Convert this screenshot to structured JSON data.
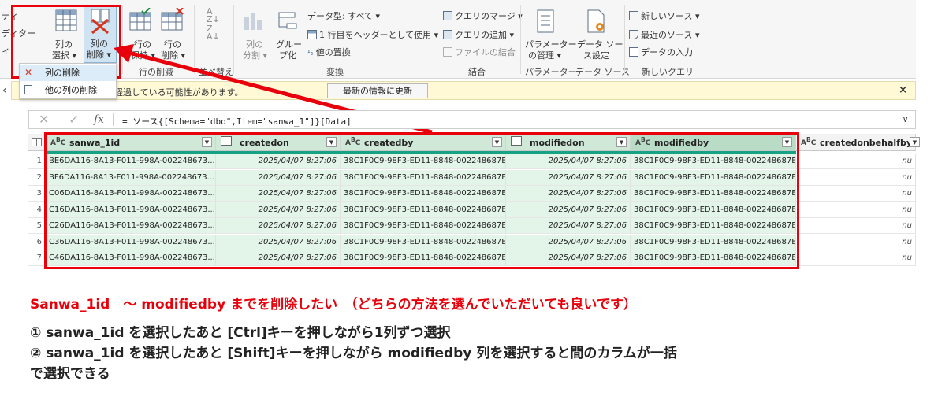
{
  "ribbon": {
    "left_partial_1": "ティ",
    "left_partial_2": "ディター",
    "left_partial_3": "ィ",
    "choose_cols_1": "列の",
    "choose_cols_2": "選択 ▾",
    "remove_cols_1": "列の",
    "remove_cols_2": "削除 ▾",
    "keep_rows_1": "行の",
    "keep_rows_2": "保持 ▾",
    "remove_rows_1": "行の",
    "remove_rows_2": "削除 ▾",
    "group_rows": "行の削減",
    "group_sort": "並べ替え",
    "split_col_1": "列の",
    "split_col_2": "分割 ▾",
    "group_by_1": "グルー",
    "group_by_2": "プ化",
    "data_type": "データ型: すべて ▾",
    "first_row_header": "1 行目をヘッダーとして使用 ▾",
    "replace_values": "値の置換",
    "group_transform": "変換",
    "merge_queries": "クエリのマージ ▾",
    "append_queries": "クエリの追加 ▾",
    "combine_files": "ファイルの結合",
    "group_combine": "結合",
    "manage_params_1": "パラメーター",
    "manage_params_2": "の管理 ▾",
    "group_params": "パラメーター",
    "data_source_1": "データ ソー",
    "data_source_2": "ス設定",
    "group_datasource": "データ ソース",
    "new_source": "新しいソース ▾",
    "recent_sources": "最近のソース ▾",
    "enter_data": "データの入力",
    "group_newquery": "新しいクエリ"
  },
  "context_menu": {
    "remove_columns": "列の削除",
    "remove_other_columns": "他の列の削除"
  },
  "notification": {
    "text": "ーは最大 21 日経過している可能性があります。",
    "refresh_button": "最新の情報に更新",
    "close": "×"
  },
  "formula_bar": {
    "cancel": "✕",
    "confirm": "✓",
    "fx": "fx",
    "formula": "= ソース{[Schema=\"dbo\",Item=\"sanwa_1\"]}[Data]",
    "expand": "∨"
  },
  "table": {
    "columns": [
      {
        "name": "sanwa_1id",
        "type_icon": "ABC"
      },
      {
        "name": "createdon",
        "type_icon": "date"
      },
      {
        "name": "createdby",
        "type_icon": "ABC"
      },
      {
        "name": "modifiedon",
        "type_icon": "date"
      },
      {
        "name": "modifiedby",
        "type_icon": "ABC"
      },
      {
        "name": "createdonbehalfby",
        "type_icon": "ABC"
      }
    ],
    "rows": [
      {
        "n": "1",
        "id": "BE6DA116-8A13-F011-998A-002248673...",
        "createdon": "2025/04/07 8:27:06",
        "createdby": "38C1F0C9-98F3-ED11-8848-002248687E...",
        "modifiedon": "2025/04/07 8:27:06",
        "modifiedby": "38C1F0C9-98F3-ED11-8848-002248687E...",
        "behalf": "nu"
      },
      {
        "n": "2",
        "id": "BF6DA116-8A13-F011-998A-002248673...",
        "createdon": "2025/04/07 8:27:06",
        "createdby": "38C1F0C9-98F3-ED11-8848-002248687E...",
        "modifiedon": "2025/04/07 8:27:06",
        "modifiedby": "38C1F0C9-98F3-ED11-8848-002248687E...",
        "behalf": "nu"
      },
      {
        "n": "3",
        "id": "C06DA116-8A13-F011-998A-002248673...",
        "createdon": "2025/04/07 8:27:06",
        "createdby": "38C1F0C9-98F3-ED11-8848-002248687E...",
        "modifiedon": "2025/04/07 8:27:06",
        "modifiedby": "38C1F0C9-98F3-ED11-8848-002248687E...",
        "behalf": "nu"
      },
      {
        "n": "4",
        "id": "C16DA116-8A13-F011-998A-002248673...",
        "createdon": "2025/04/07 8:27:06",
        "createdby": "38C1F0C9-98F3-ED11-8848-002248687E...",
        "modifiedon": "2025/04/07 8:27:06",
        "modifiedby": "38C1F0C9-98F3-ED11-8848-002248687E...",
        "behalf": "nu"
      },
      {
        "n": "5",
        "id": "C26DA116-8A13-F011-998A-002248673...",
        "createdon": "2025/04/07 8:27:06",
        "createdby": "38C1F0C9-98F3-ED11-8848-002248687E...",
        "modifiedon": "2025/04/07 8:27:06",
        "modifiedby": "38C1F0C9-98F3-ED11-8848-002248687E...",
        "behalf": "nu"
      },
      {
        "n": "6",
        "id": "C36DA116-8A13-F011-998A-002248673...",
        "createdon": "2025/04/07 8:27:06",
        "createdby": "38C1F0C9-98F3-ED11-8848-002248687E...",
        "modifiedon": "2025/04/07 8:27:06",
        "modifiedby": "38C1F0C9-98F3-ED11-8848-002248687E...",
        "behalf": "nu"
      },
      {
        "n": "7",
        "id": "C46DA116-8A13-F011-998A-002248673...",
        "createdon": "2025/04/07 8:27:06",
        "createdby": "38C1F0C9-98F3-ED11-8848-002248687E...",
        "modifiedon": "2025/04/07 8:27:06",
        "modifiedby": "38C1F0C9-98F3-ED11-8848-002248687E...",
        "behalf": "nu"
      }
    ]
  },
  "annotation": {
    "title": "Sanwa_1id　～ modifiedby までを削除したい　（どちらの方法を選んでいただいても良いです）",
    "line1": "① sanwa_1id を選択したあと [Ctrl]キーを押しながら1列ずつ選択",
    "line2": "② sanwa_1id を選択したあと [Shift]キーを押しながら modifiedby 列を選択すると間のカラムが一括",
    "line3": "で選択できる"
  },
  "colors": {
    "highlight_red": "#e8000b",
    "selected_column": "#cfe8d8",
    "selection_bar": "#15a384",
    "notification_bg": "#fff9d6"
  }
}
